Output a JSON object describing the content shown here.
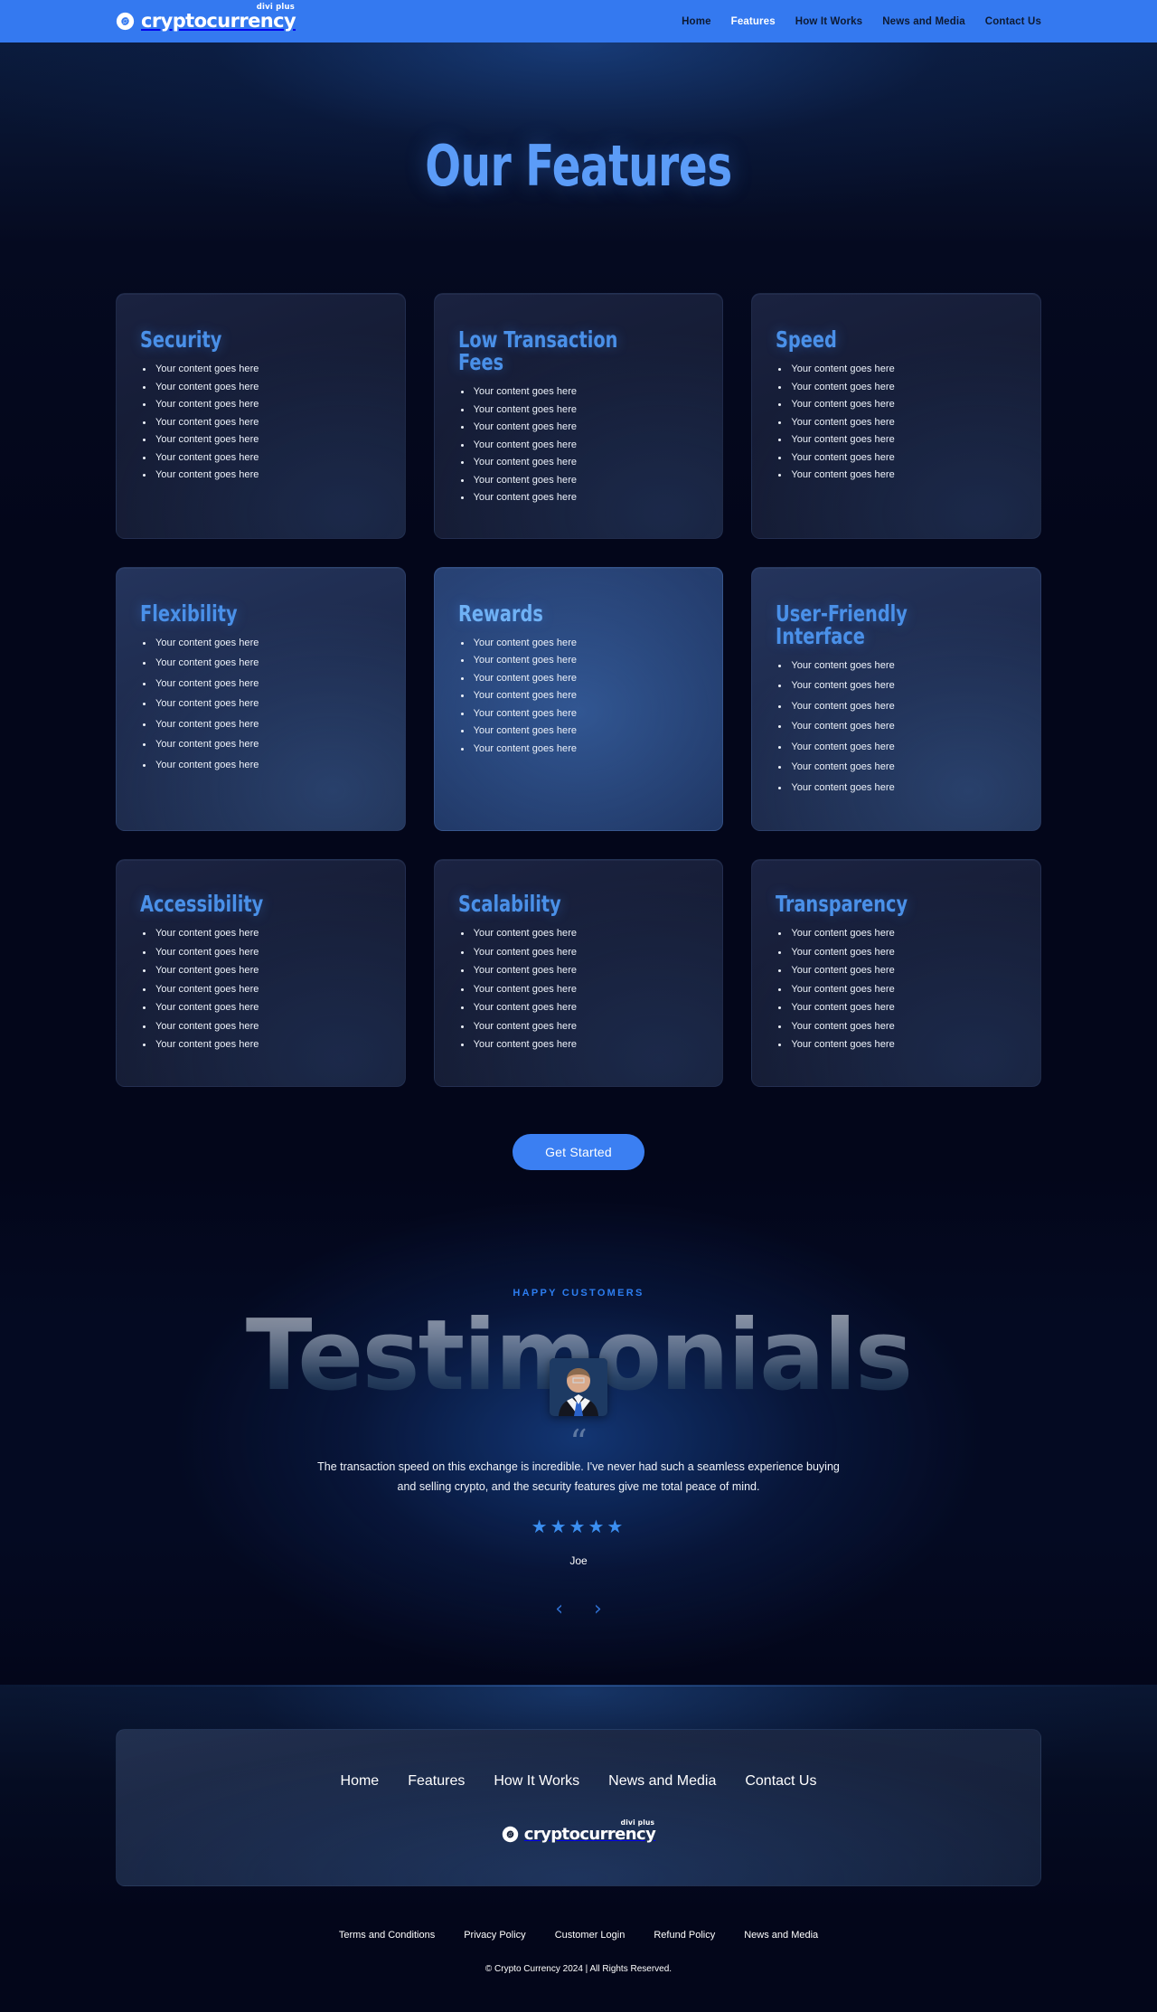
{
  "header": {
    "logo": {
      "name": "cryptocurrency",
      "sub": "divi plus",
      "icon": "crypto-coin-icon"
    },
    "nav": [
      {
        "label": "Home",
        "active": false
      },
      {
        "label": "Features",
        "active": true
      },
      {
        "label": "How It Works",
        "active": false
      },
      {
        "label": "News and Media",
        "active": false
      },
      {
        "label": "Contact Us",
        "active": false
      }
    ]
  },
  "features": {
    "title": "Our Features",
    "bullet_text": "Your content goes here",
    "cards": [
      {
        "title": "Security",
        "bullets": 7,
        "variant": "row1"
      },
      {
        "title": "Low Transaction Fees",
        "bullets": 7,
        "variant": "row1"
      },
      {
        "title": "Speed",
        "bullets": 7,
        "variant": "row1"
      },
      {
        "title": "Flexibility",
        "bullets": 7,
        "variant": "row2"
      },
      {
        "title": "Rewards",
        "bullets": 7,
        "variant": "highlight"
      },
      {
        "title": "User-Friendly Interface",
        "bullets": 7,
        "variant": "row2"
      },
      {
        "title": "Accessibility",
        "bullets": 7,
        "variant": "row3"
      },
      {
        "title": "Scalability",
        "bullets": 7,
        "variant": "row3"
      },
      {
        "title": "Transparency",
        "bullets": 7,
        "variant": "row3"
      }
    ],
    "cta_label": "Get Started"
  },
  "testimonials": {
    "eyebrow": "HAPPY CUSTOMERS",
    "heading": "Testimonials",
    "quote_mark": "“",
    "quote": "The transaction speed on this exchange is incredible. I've never had such a seamless experience buying and selling crypto, and the security features give me total peace of mind.",
    "stars": "★★★★★",
    "rating": 5,
    "author": "Joe",
    "prev_icon": "‹",
    "next_icon": "›"
  },
  "footer": {
    "nav": [
      "Home",
      "Features",
      "How It Works",
      "News and Media",
      "Contact Us"
    ],
    "logo": {
      "name": "cryptocurrency",
      "sub": "divi plus",
      "icon": "crypto-coin-icon"
    },
    "links": [
      "Terms and Conditions",
      "Privacy Policy",
      "Customer Login",
      "Refund Policy",
      "News and Media"
    ],
    "copyright": "© Crypto Currency 2024 | All Rights Reserved."
  },
  "colors": {
    "header_blue": "#3479f0",
    "accent_blue": "#3b7ff2",
    "title_blue": "#5b9cf8",
    "card_title_blue": "#4a90e8",
    "star_blue": "#3b8ef0",
    "page_bg": "#03061a"
  }
}
